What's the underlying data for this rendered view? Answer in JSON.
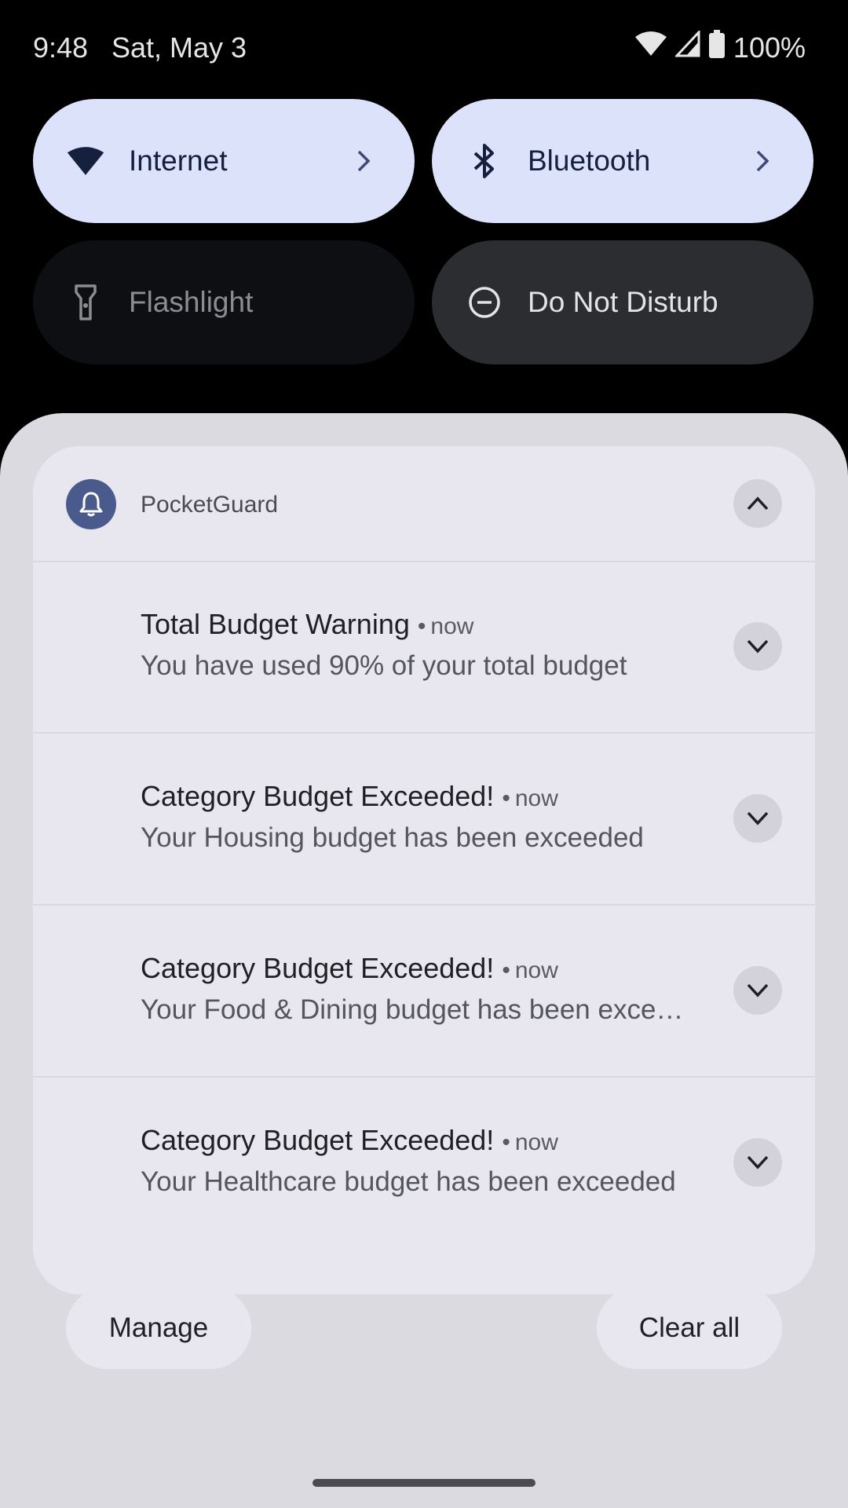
{
  "status_bar": {
    "time": "9:48",
    "date": "Sat, May 3",
    "battery": "100%",
    "icons": [
      "wifi-icon",
      "cell-signal-icon",
      "battery-icon"
    ]
  },
  "quick_settings": {
    "tiles": [
      {
        "label": "Internet",
        "icon": "wifi-icon",
        "state": "on"
      },
      {
        "label": "Bluetooth",
        "icon": "bluetooth-icon",
        "state": "on"
      },
      {
        "label": "Flashlight",
        "icon": "flashlight-icon",
        "state": "off"
      },
      {
        "label": "Do Not Disturb",
        "icon": "do-not-disturb-icon",
        "state": "off"
      }
    ]
  },
  "notification_group": {
    "app_name": "PocketGuard",
    "app_icon": "bell-icon",
    "accent": "#4a5a8d",
    "notifications": [
      {
        "title": "Total Budget Warning",
        "time": "now",
        "text": "You have used 90% of your total budget"
      },
      {
        "title": "Category Budget Exceeded!",
        "time": "now",
        "text": "Your Housing budget has been exceeded"
      },
      {
        "title": "Category Budget Exceeded!",
        "time": "now",
        "text": "Your Food & Dining budget has been exceeded"
      },
      {
        "title": "Category Budget Exceeded!",
        "time": "now",
        "text": "Your Healthcare budget has been exceeded"
      }
    ]
  },
  "actions": {
    "manage": "Manage",
    "clear_all": "Clear all"
  }
}
